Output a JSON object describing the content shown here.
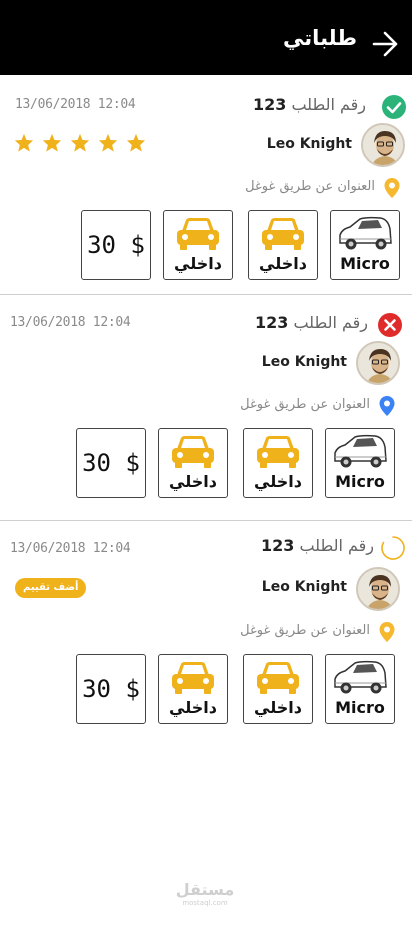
{
  "header": {
    "title": "طلباتي"
  },
  "orders": [
    {
      "date": "13/06/2018 12:04",
      "order_label": "رقم الطلب",
      "order_number": "123",
      "status": "completed",
      "name": "Leo Knight",
      "address": "العنوان عن طريق غوغل",
      "rating": 5,
      "car_type": "Micro",
      "option_1": "داخلي",
      "option_2": "داخلي",
      "price": "30 $"
    },
    {
      "date": "13/06/2018 12:04",
      "order_label": "رقم الطلب",
      "order_number": "123",
      "status": "cancelled",
      "name": "Leo Knight",
      "address": "العنوان عن طريق غوغل",
      "car_type": "Micro",
      "option_1": "داخلي",
      "option_2": "داخلي",
      "price": "30 $"
    },
    {
      "date": "13/06/2018 12:04",
      "order_label": "رقم الطلب",
      "order_number": "123",
      "status": "pending",
      "name": "Leo Knight",
      "address": "العنوان عن طريق غوغل",
      "rate_button": "أضف تقييم",
      "car_type": "Micro",
      "option_1": "داخلي",
      "option_2": "داخلي",
      "price": "30 $"
    }
  ],
  "watermark": {
    "main": "مستقل",
    "sub": "mostaql.com"
  },
  "colors": {
    "accent": "#f0b21b",
    "success": "#2bb37a",
    "danger": "#e02b2b",
    "pin_yellow": "#f5b82e",
    "pin_blue": "#3b82f6"
  }
}
